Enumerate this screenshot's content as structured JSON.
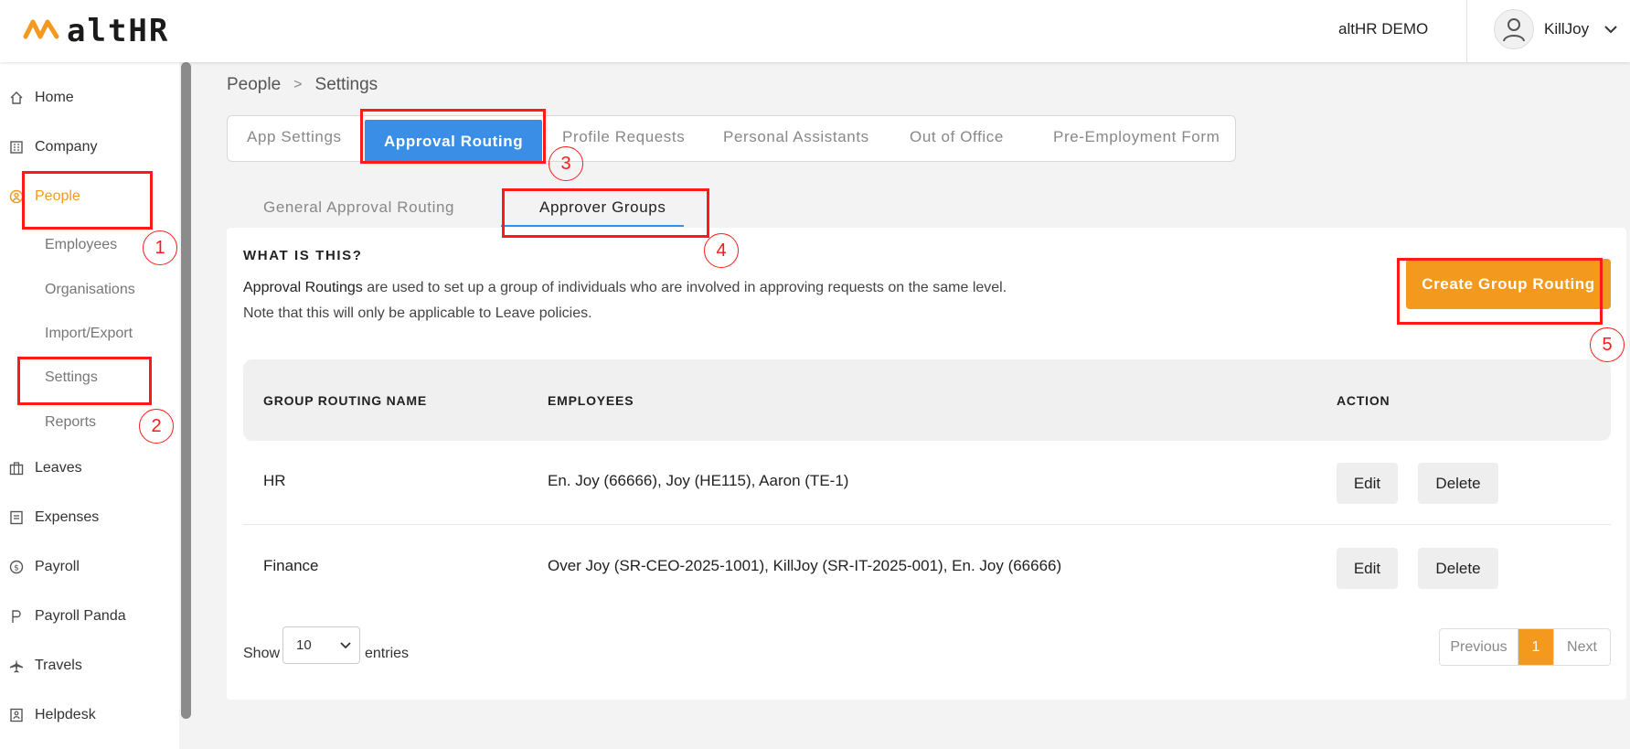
{
  "header": {
    "logo_text": "altHR",
    "org_name": "altHR DEMO",
    "user_name": "KillJoy"
  },
  "sidebar": {
    "items": [
      {
        "label": "Home",
        "icon": "home-icon"
      },
      {
        "label": "Company",
        "icon": "building-icon"
      },
      {
        "label": "People",
        "icon": "people-icon",
        "active": true
      },
      {
        "label": "Leaves",
        "icon": "briefcase-icon"
      },
      {
        "label": "Expenses",
        "icon": "receipt-icon"
      },
      {
        "label": "Payroll",
        "icon": "dollar-icon"
      },
      {
        "label": "Payroll Panda",
        "icon": "p-icon"
      },
      {
        "label": "Travels",
        "icon": "plane-icon"
      },
      {
        "label": "Helpdesk",
        "icon": "helpdesk-icon"
      }
    ],
    "sub_items": [
      "Employees",
      "Organisations",
      "Import/Export",
      "Settings",
      "Reports"
    ]
  },
  "annotations": [
    "1",
    "2",
    "3",
    "4",
    "5"
  ],
  "breadcrumb": {
    "parent": "People",
    "separator": ">",
    "current": "Settings"
  },
  "top_tabs": [
    "App Settings",
    "Approval Routing",
    "Profile Requests",
    "Personal Assistants",
    "Out of Office",
    "Pre-Employment Form"
  ],
  "sub_tabs": [
    "General Approval Routing",
    "Approver Groups"
  ],
  "info": {
    "title": "WHAT IS THIS?",
    "desc_bold": "Approval Routings",
    "desc_rest": " are used to set up a group of individuals who are involved in approving requests on the same level.",
    "desc2": "Note that this will only be applicable to Leave policies."
  },
  "create_button": "Create Group Routing",
  "table": {
    "headers": [
      "GROUP ROUTING NAME",
      "EMPLOYEES",
      "ACTION"
    ],
    "rows": [
      {
        "name": "HR",
        "employees": "En. Joy (66666), Joy (HE115), Aaron (TE-1)",
        "edit": "Edit",
        "delete": "Delete"
      },
      {
        "name": "Finance",
        "employees": "Over Joy (SR-CEO-2025-1001), KillJoy (SR-IT-2025-001), En. Joy (66666)",
        "edit": "Edit",
        "delete": "Delete"
      }
    ]
  },
  "footer": {
    "show": "Show",
    "page_size": "10",
    "entries": "entries",
    "previous": "Previous",
    "page": "1",
    "next": "Next"
  },
  "colors": {
    "accent_orange": "#f39a1e",
    "tab_blue": "#3a8ee6",
    "annotation_red": "#ff1a1a"
  }
}
